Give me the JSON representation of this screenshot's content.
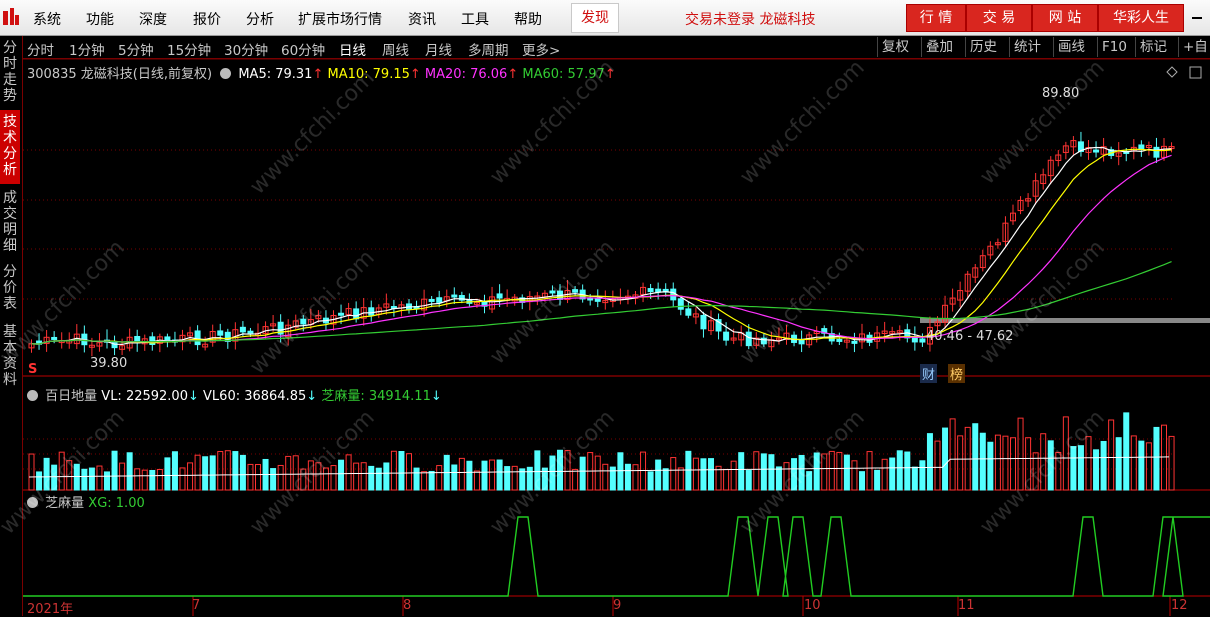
{
  "menubar": {
    "items": [
      "系统",
      "功能",
      "深度",
      "报价",
      "分析",
      "扩展市场行情",
      "资讯",
      "工具",
      "帮助"
    ],
    "find_label": "发现",
    "login_status": "交易未登录 龙磁科技",
    "right_buttons": [
      "行 情",
      "交 易",
      "网 站",
      "华彩人生"
    ]
  },
  "left_tabs": [
    "分时走势",
    "技术分析",
    "成交明细",
    "分价表",
    "基本资料"
  ],
  "period_bar": {
    "periods": [
      "分时",
      "1分钟",
      "5分钟",
      "15分钟",
      "30分钟",
      "60分钟",
      "日线",
      "周线",
      "月线",
      "多周期",
      "更多>"
    ],
    "active": "日线",
    "tools": [
      "复权",
      "叠加",
      "历史",
      "统计",
      "画线",
      "F10",
      "标记",
      "+自"
    ]
  },
  "main_chart": {
    "stock": "300835 龙磁科技(日线,前复权)",
    "ma": [
      {
        "label": "MA5: 79.31",
        "arrow": "↑",
        "color": "#ffffff"
      },
      {
        "label": "MA10: 79.15",
        "arrow": "↑",
        "color": "#ffff00"
      },
      {
        "label": "MA20: 76.06",
        "arrow": "↑",
        "color": "#ff33ff"
      },
      {
        "label": "MA60: 57.97",
        "arrow": "↑",
        "color": "#33cc33"
      }
    ],
    "high_label": "89.80",
    "low_label": "39.80",
    "range_label": "40.46 - 47.62",
    "tag_cai": "财",
    "tag_bang": "榜",
    "tag_s": "S"
  },
  "volume_panel": {
    "title": "百日地量",
    "vl": "VL: 22592.00",
    "vl_arrow": "↓",
    "vl60": "VL60: 36864.85",
    "vl60_arrow": "↓",
    "zmq": "芝麻量: 34914.11",
    "zmq_arrow": "↓"
  },
  "signal_panel": {
    "title": "芝麻量",
    "xg": "XG: 1.00"
  },
  "time_axis": [
    "2021年",
    "7",
    "8",
    "9",
    "10",
    "11",
    "12"
  ],
  "watermark": "www.cfchi.com",
  "colors": {
    "up": "#ff3333",
    "down": "#54ffff",
    "ma5": "#ffffff",
    "ma10": "#ffff00",
    "ma20": "#ff33ff",
    "ma60": "#33cc33",
    "grid": "#7a0000"
  }
}
